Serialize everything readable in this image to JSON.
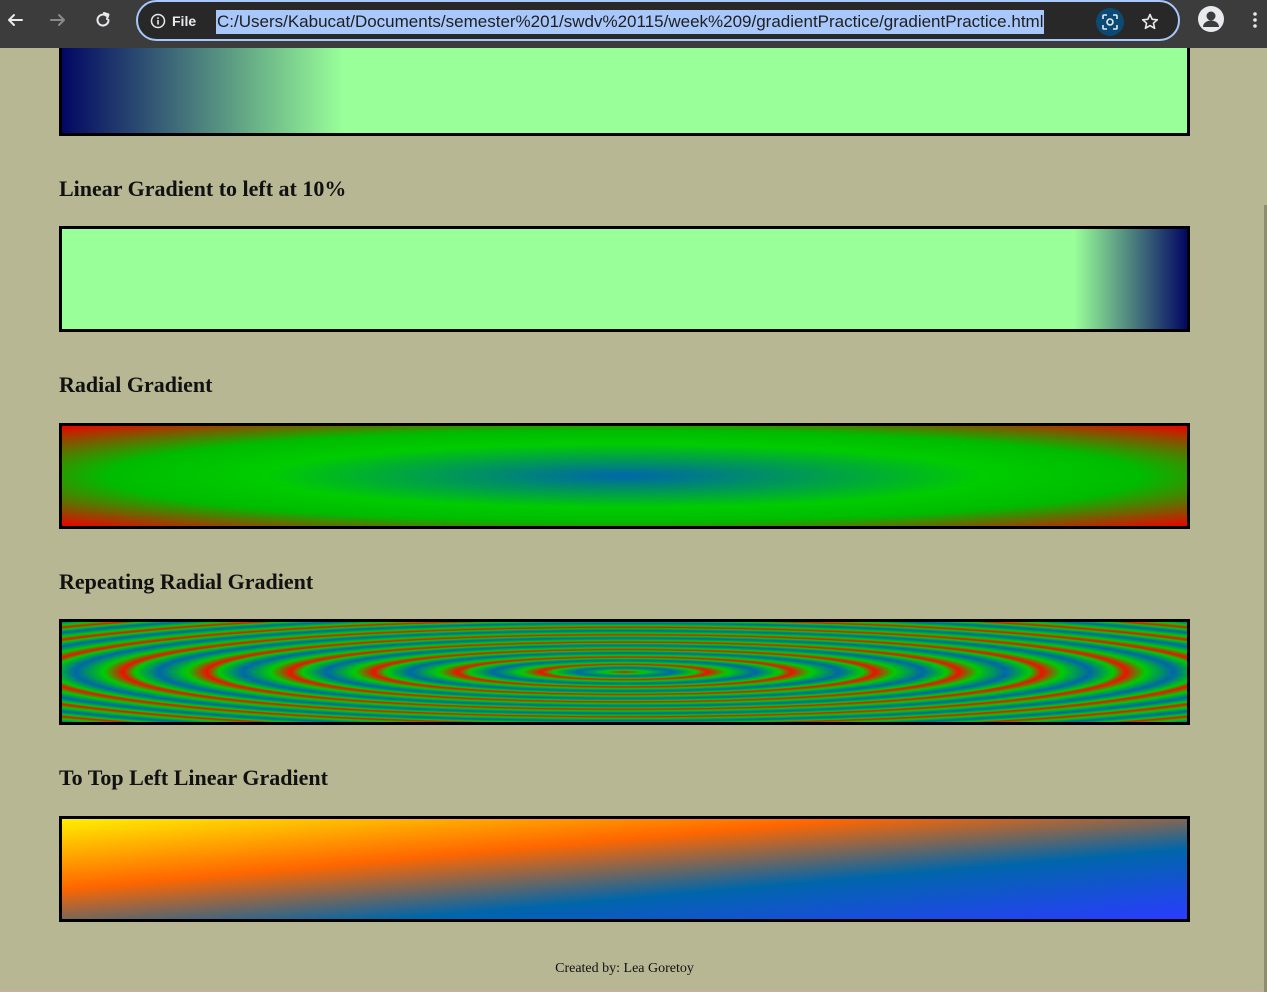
{
  "browser": {
    "site_info_label": "File",
    "url": "C:/Users/Kabucat/Documents/semester%201/swdv%20115/week%209/gradientPractice/gradientPractice.html"
  },
  "sections": [
    {
      "heading": "Linear Gradient to left at 10%"
    },
    {
      "heading": "Radial Gradient"
    },
    {
      "heading": "Repeating Radial Gradient"
    },
    {
      "heading": "To Top Left Linear Gradient"
    }
  ],
  "footer": {
    "text": "Created by: Lea Goretoy"
  },
  "colors": {
    "page_background": "#b8b794",
    "navy": "#020763",
    "light_green": "#99ff99",
    "green": "#00cc00",
    "red": "#ee0000",
    "teal_blue": "#0066aa",
    "blue": "#2a3cff",
    "orange": "#ff6600",
    "yellow": "#ffee00"
  }
}
